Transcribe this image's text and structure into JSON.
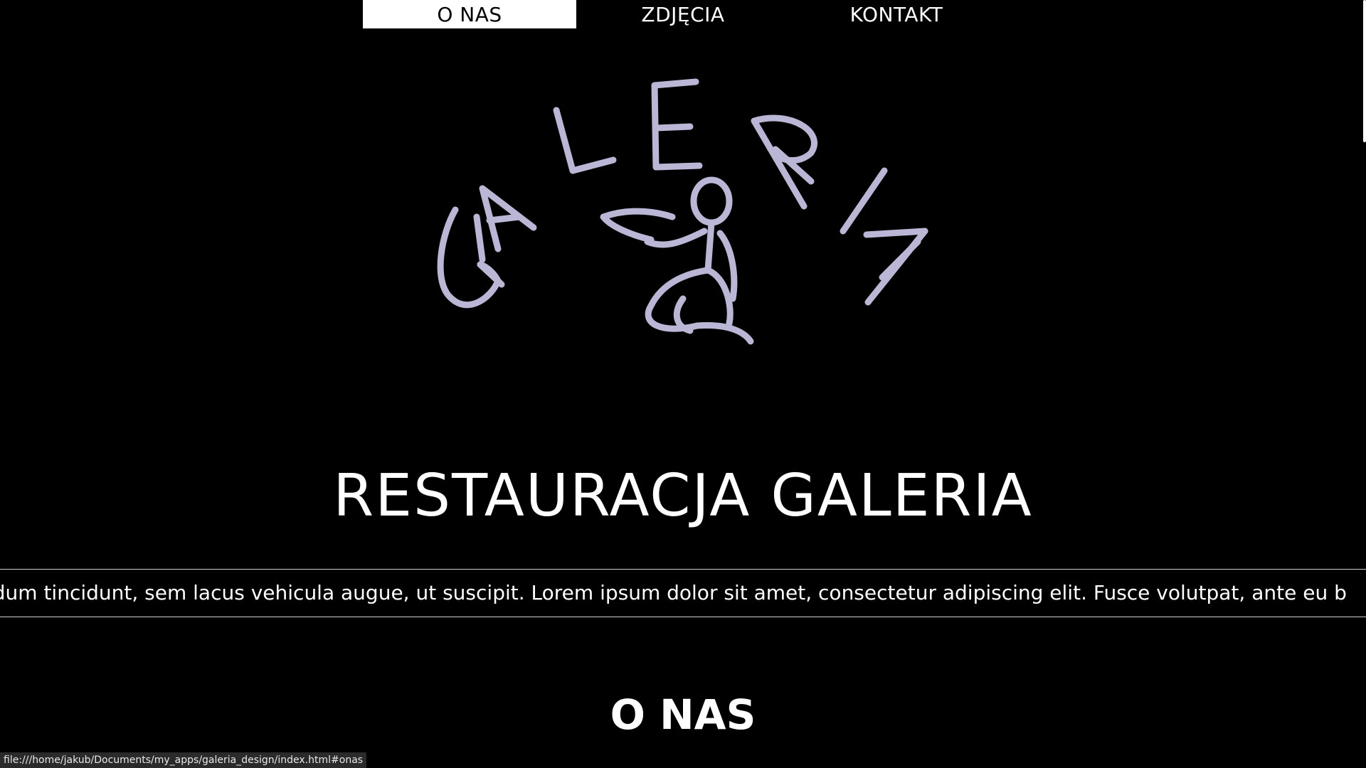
{
  "nav": {
    "items": [
      {
        "label": "O NAS",
        "active": true
      },
      {
        "label": "ZDJĘCIA",
        "active": false
      },
      {
        "label": "KONTAKT",
        "active": false
      }
    ]
  },
  "logo": {
    "text": "GALERIA",
    "stroke_color": "#b9b6d6"
  },
  "hero": {
    "title": "RESTAURACJA GALERIA"
  },
  "ticker": {
    "text": "ndum tincidunt, sem lacus vehicula augue, ut suscipit. Lorem ipsum dolor sit amet, consectetur adipiscing elit. Fusce volutpat, ante eu b"
  },
  "section": {
    "heading": "O NAS"
  },
  "status": {
    "url": "file:///home/jakub/Documents/my_apps/galeria_design/index.html#onas"
  },
  "colors": {
    "background": "#000000",
    "text": "#ffffff",
    "nav_active_bg": "#ffffff",
    "nav_active_text": "#000000"
  }
}
